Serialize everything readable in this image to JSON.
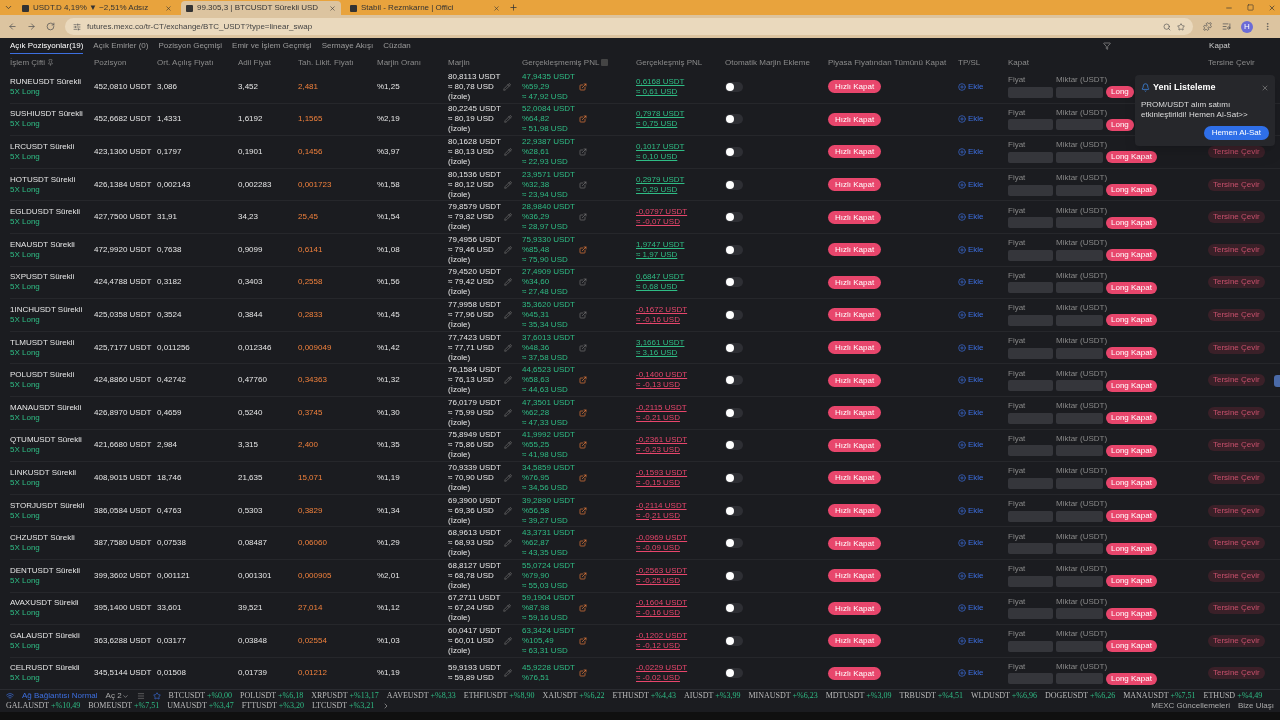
{
  "browser": {
    "tabs": [
      {
        "title": "USDT.D 4,19% ▼ −2,51% Adsız",
        "selected": false
      },
      {
        "title": "99.305,3 | BTCUSDT Sürekli USD",
        "selected": true
      },
      {
        "title": "Stabil - Rezmkarne | Offici",
        "selected": false
      }
    ],
    "url": "futures.mexc.co/tr-CT/exchange/BTC_USDT?type=linear_swap",
    "avatar": "H"
  },
  "tabs": [
    {
      "label": "Açık Pozisyonlar(19)",
      "selected": true
    },
    {
      "label": "Açık Emirler (0)",
      "selected": false
    },
    {
      "label": "Pozisyon Geçmişi",
      "selected": false
    },
    {
      "label": "Emir ve İşlem Geçmişi",
      "selected": false
    },
    {
      "label": "Sermaye Akışı",
      "selected": false
    },
    {
      "label": "Cüzdan",
      "selected": false
    }
  ],
  "tabs_right": "Kapat",
  "columns": [
    "İşlem Çifti",
    "Pozisyon",
    "Ort. Açılış Fiyatı",
    "Adil Fiyat",
    "Tah. Likit. Fiyatı",
    "Marjin Oranı",
    "Marjin",
    "Gerçekleşmemiş PNL",
    "Gerçekleşmiş PNL",
    "Otomatik Marjin Ekleme",
    "Piyasa Fiyatından Tümünü Kapat",
    "TP/SL",
    "Kapat",
    "Tersine Çevir"
  ],
  "rows": [
    {
      "pair": "RUNEUSDT Sürekli",
      "leverage": "5X Long",
      "position": "452,0810 USDT",
      "entry": "3,086",
      "fair": "3,452",
      "liq": "2,481",
      "ratio": "%1,25",
      "margin": [
        "80,8113 USDT",
        "≈ 80,78 USD",
        "(İzole)"
      ],
      "unrealized": [
        "47,9435 USDT",
        "%59,29",
        "≈ 47,92 USD"
      ],
      "share_highlighted": true,
      "realized": [
        "0,6168 USDT",
        "≈ 0,61 USD"
      ],
      "positive": true,
      "auto_margin_on": false,
      "quick_close": "Hızlı Kapat",
      "tpsl": "Ekle",
      "price_label": "Fiyat",
      "qty_label": "Miktar (USDT)",
      "close": "Long"
    },
    {
      "pair": "SUSHIUSDT Sürekli",
      "leverage": "5X Long",
      "position": "452,6682 USDT",
      "entry": "1,4331",
      "fair": "1,6192",
      "liq": "1,1565",
      "ratio": "%2,19",
      "margin": [
        "80,2245 USDT",
        "≈ 80,19 USD",
        "(İzole)"
      ],
      "unrealized": [
        "52,0084 USDT",
        "%64,82",
        "≈ 51,98 USD"
      ],
      "share_highlighted": true,
      "realized": [
        "0,7978 USDT",
        "≈ 0,75 USD"
      ],
      "positive": true,
      "auto_margin_on": false,
      "quick_close": "Hızlı Kapat",
      "tpsl": "Ekle",
      "price_label": "Fiyat",
      "qty_label": "Miktar (USDT)",
      "close": "Long"
    },
    {
      "pair": "LRCUSDT Sürekli",
      "leverage": "5X Long",
      "position": "423,1300 USDT",
      "entry": "0,1797",
      "fair": "0,1901",
      "liq": "0,1456",
      "ratio": "%3,97",
      "margin": [
        "80,1628 USDT",
        "≈ 80,13 USD",
        "(İzole)"
      ],
      "unrealized": [
        "22,9387 USDT",
        "%28,61",
        "≈ 22,93 USD"
      ],
      "share_highlighted": false,
      "realized": [
        "0,1017 USDT",
        "≈ 0,10 USD"
      ],
      "positive": true,
      "auto_margin_on": false,
      "quick_close": "Hızlı Kapat",
      "tpsl": "Ekle",
      "price_label": "Fiyat",
      "qty_label": "Miktar (USDT)",
      "close": "Long Kapat",
      "reverse": "Tersine Çevir"
    },
    {
      "pair": "HOTUSDT Sürekli",
      "leverage": "5X Long",
      "position": "426,1384 USDT",
      "entry": "0,002143",
      "fair": "0,002283",
      "liq": "0,001723",
      "ratio": "%1,58",
      "margin": [
        "80,1536 USDT",
        "≈ 80,12 USD",
        "(İzole)"
      ],
      "unrealized": [
        "23,9571 USDT",
        "%32,38",
        "≈ 23,94 USD"
      ],
      "share_highlighted": false,
      "realized": [
        "0,2979 USDT",
        "≈ 0,29 USD"
      ],
      "positive": true,
      "auto_margin_on": false,
      "quick_close": "Hızlı Kapat",
      "tpsl": "Ekle",
      "price_label": "Fiyat",
      "qty_label": "Miktar (USDT)",
      "close": "Long Kapat",
      "reverse": "Tersine Çevir"
    },
    {
      "pair": "EGLDUSDT Sürekli",
      "leverage": "5X Long",
      "position": "427,7500 USDT",
      "entry": "31,91",
      "fair": "34,23",
      "liq": "25,45",
      "ratio": "%1,54",
      "margin": [
        "79,8579 USDT",
        "≈ 79,82 USD",
        "(İzole)"
      ],
      "unrealized": [
        "28,9840 USDT",
        "%36,29",
        "≈ 28,97 USD"
      ],
      "share_highlighted": false,
      "realized": [
        "-0,0797 USDT",
        "≈ -0,07 USD"
      ],
      "positive": false,
      "auto_margin_on": false,
      "quick_close": "Hızlı Kapat",
      "tpsl": "Ekle",
      "price_label": "Fiyat",
      "qty_label": "Miktar (USDT)",
      "close": "Long Kapat",
      "reverse": "Tersine Çevir"
    },
    {
      "pair": "ENAUSDT Sürekli",
      "leverage": "5X Long",
      "position": "472,9920 USDT",
      "entry": "0,7638",
      "fair": "0,9099",
      "liq": "0,6141",
      "ratio": "%1,08",
      "margin": [
        "79,4956 USDT",
        "≈ 79,46 USD",
        "(İzole)"
      ],
      "unrealized": [
        "75,9330 USDT",
        "%85,48",
        "≈ 75,90 USD"
      ],
      "share_highlighted": true,
      "realized": [
        "1,9747 USDT",
        "≈ 1,97 USD"
      ],
      "positive": true,
      "auto_margin_on": false,
      "quick_close": "Hızlı Kapat",
      "tpsl": "Ekle",
      "price_label": "Fiyat",
      "qty_label": "Miktar (USDT)",
      "close": "Long Kapat",
      "reverse": "Tersine Çevir"
    },
    {
      "pair": "SXPUSDT Sürekli",
      "leverage": "5X Long",
      "position": "424,4788 USDT",
      "entry": "0,3182",
      "fair": "0,3403",
      "liq": "0,2558",
      "ratio": "%1,56",
      "margin": [
        "79,4520 USDT",
        "≈ 79,42 USD",
        "(İzole)"
      ],
      "unrealized": [
        "27,4909 USDT",
        "%34,60",
        "≈ 27,48 USD"
      ],
      "share_highlighted": false,
      "realized": [
        "0,6847 USDT",
        "≈ 0,68 USD"
      ],
      "positive": true,
      "auto_margin_on": false,
      "quick_close": "Hızlı Kapat",
      "tpsl": "Ekle",
      "price_label": "Fiyat",
      "qty_label": "Miktar (USDT)",
      "close": "Long Kapat",
      "reverse": "Tersine Çevir"
    },
    {
      "pair": "1INCHUSDT Sürekli",
      "leverage": "5X Long",
      "position": "425,0358 USDT",
      "entry": "0,3524",
      "fair": "0,3844",
      "liq": "0,2833",
      "ratio": "%1,45",
      "margin": [
        "77,9958 USDT",
        "≈ 77,96 USD",
        "(İzole)"
      ],
      "unrealized": [
        "35,3620 USDT",
        "%45,31",
        "≈ 35,34 USD"
      ],
      "share_highlighted": false,
      "realized": [
        "-0,1672 USDT",
        "≈ -0,16 USD"
      ],
      "positive": false,
      "auto_margin_on": false,
      "quick_close": "Hızlı Kapat",
      "tpsl": "Ekle",
      "price_label": "Fiyat",
      "qty_label": "Miktar (USDT)",
      "close": "Long Kapat",
      "reverse": "Tersine Çevir"
    },
    {
      "pair": "TLMUSDT Sürekli",
      "leverage": "5X Long",
      "position": "425,7177 USDT",
      "entry": "0,011256",
      "fair": "0,012346",
      "liq": "0,009049",
      "ratio": "%1,42",
      "margin": [
        "77,7423 USDT",
        "≈ 77,71 USD",
        "(İzole)"
      ],
      "unrealized": [
        "37,6013 USDT",
        "%48,36",
        "≈ 37,58 USD"
      ],
      "share_highlighted": false,
      "realized": [
        "3,1661 USDT",
        "≈ 3,16 USD"
      ],
      "positive": true,
      "auto_margin_on": false,
      "quick_close": "Hızlı Kapat",
      "tpsl": "Ekle",
      "price_label": "Fiyat",
      "qty_label": "Miktar (USDT)",
      "close": "Long Kapat",
      "reverse": "Tersine Çevir"
    },
    {
      "pair": "POLUSDT Sürekli",
      "leverage": "5X Long",
      "position": "424,8860 USDT",
      "entry": "0,42742",
      "fair": "0,47760",
      "liq": "0,34363",
      "ratio": "%1,32",
      "margin": [
        "76,1584 USDT",
        "≈ 76,13 USD",
        "(İzole)"
      ],
      "unrealized": [
        "44,6523 USDT",
        "%58,63",
        "≈ 44,63 USD"
      ],
      "share_highlighted": true,
      "realized": [
        "-0,1400 USDT",
        "≈ -0,13 USD"
      ],
      "positive": false,
      "auto_margin_on": false,
      "quick_close": "Hızlı Kapat",
      "tpsl": "Ekle",
      "price_label": "Fiyat",
      "qty_label": "Miktar (USDT)",
      "close": "Long Kapat",
      "reverse": "Tersine Çevir"
    },
    {
      "pair": "MANAUSDT Sürekli",
      "leverage": "5X Long",
      "position": "426,8970 USDT",
      "entry": "0,4659",
      "fair": "0,5240",
      "liq": "0,3745",
      "ratio": "%1,30",
      "margin": [
        "76,0179 USDT",
        "≈ 75,99 USD",
        "(İzole)"
      ],
      "unrealized": [
        "47,3501 USDT",
        "%62,28",
        "≈ 47,33 USD"
      ],
      "share_highlighted": true,
      "realized": [
        "-0,2115 USDT",
        "≈ -0,21 USD"
      ],
      "positive": false,
      "auto_margin_on": false,
      "quick_close": "Hızlı Kapat",
      "tpsl": "Ekle",
      "price_label": "Fiyat",
      "qty_label": "Miktar (USDT)",
      "close": "Long Kapat",
      "reverse": "Tersine Çevir"
    },
    {
      "pair": "QTUMUSDT Sürekli",
      "leverage": "5X Long",
      "position": "421,6680 USDT",
      "entry": "2,984",
      "fair": "3,315",
      "liq": "2,400",
      "ratio": "%1,35",
      "margin": [
        "75,8949 USDT",
        "≈ 75,86 USD",
        "(İzole)"
      ],
      "unrealized": [
        "41,9992 USDT",
        "%55,25",
        "≈ 41,98 USD"
      ],
      "share_highlighted": true,
      "realized": [
        "-0,2361 USDT",
        "≈ -0,23 USD"
      ],
      "positive": false,
      "auto_margin_on": false,
      "quick_close": "Hızlı Kapat",
      "tpsl": "Ekle",
      "price_label": "Fiyat",
      "qty_label": "Miktar (USDT)",
      "close": "Long Kapat",
      "reverse": "Tersine Çevir"
    },
    {
      "pair": "LINKUSDT Sürekli",
      "leverage": "5X Long",
      "position": "408,9015 USDT",
      "entry": "18,746",
      "fair": "21,635",
      "liq": "15,071",
      "ratio": "%1,19",
      "margin": [
        "70,9339 USDT",
        "≈ 70,90 USD",
        "(İzole)"
      ],
      "unrealized": [
        "34,5859 USDT",
        "%76,95",
        "≈ 34,56 USD"
      ],
      "share_highlighted": true,
      "realized": [
        "-0,1593 USDT",
        "≈ -0,15 USD"
      ],
      "positive": false,
      "auto_margin_on": false,
      "quick_close": "Hızlı Kapat",
      "tpsl": "Ekle",
      "price_label": "Fiyat",
      "qty_label": "Miktar (USDT)",
      "close": "Long Kapat",
      "reverse": "Tersine Çevir"
    },
    {
      "pair": "STORJUSDT Sürekli",
      "leverage": "5X Long",
      "position": "386,0584 USDT",
      "entry": "0,4763",
      "fair": "0,5303",
      "liq": "0,3829",
      "ratio": "%1,34",
      "margin": [
        "69,3900 USDT",
        "≈ 69,36 USD",
        "(İzole)"
      ],
      "unrealized": [
        "39,2890 USDT",
        "%56,58",
        "≈ 39,27 USD"
      ],
      "share_highlighted": true,
      "realized": [
        "-0,2114 USDT",
        "≈ -0,21 USD"
      ],
      "positive": false,
      "auto_margin_on": false,
      "quick_close": "Hızlı Kapat",
      "tpsl": "Ekle",
      "price_label": "Fiyat",
      "qty_label": "Miktar (USDT)",
      "close": "Long Kapat",
      "reverse": "Tersine Çevir"
    },
    {
      "pair": "CHZUSDT Sürekli",
      "leverage": "5X Long",
      "position": "387,7580 USDT",
      "entry": "0,07538",
      "fair": "0,08487",
      "liq": "0,06060",
      "ratio": "%1,29",
      "margin": [
        "68,9613 USDT",
        "≈ 68,93 USD",
        "(İzole)"
      ],
      "unrealized": [
        "43,3731 USDT",
        "%62,87",
        "≈ 43,35 USD"
      ],
      "share_highlighted": true,
      "realized": [
        "-0,0969 USDT",
        "≈ -0,09 USD"
      ],
      "positive": false,
      "auto_margin_on": false,
      "quick_close": "Hızlı Kapat",
      "tpsl": "Ekle",
      "price_label": "Fiyat",
      "qty_label": "Miktar (USDT)",
      "close": "Long Kapat",
      "reverse": "Tersine Çevir"
    },
    {
      "pair": "DENTUSDT Sürekli",
      "leverage": "5X Long",
      "position": "399,3602 USDT",
      "entry": "0,001121",
      "fair": "0,001301",
      "liq": "0,000905",
      "ratio": "%2,01",
      "margin": [
        "68,8127 USDT",
        "≈ 68,78 USD",
        "(İzole)"
      ],
      "unrealized": [
        "55,0724 USDT",
        "%79,90",
        "≈ 55,03 USD"
      ],
      "share_highlighted": true,
      "realized": [
        "-0,2563 USDT",
        "≈ -0,25 USD"
      ],
      "positive": false,
      "auto_margin_on": false,
      "quick_close": "Hızlı Kapat",
      "tpsl": "Ekle",
      "price_label": "Fiyat",
      "qty_label": "Miktar (USDT)",
      "close": "Long Kapat",
      "reverse": "Tersine Çevir"
    },
    {
      "pair": "AVAXUSDT Sürekli",
      "leverage": "5X Long",
      "position": "395,1400 USDT",
      "entry": "33,601",
      "fair": "39,521",
      "liq": "27,014",
      "ratio": "%1,12",
      "margin": [
        "67,2711 USDT",
        "≈ 67,24 USD",
        "(İzole)"
      ],
      "unrealized": [
        "59,1904 USDT",
        "%87,98",
        "≈ 59,16 USD"
      ],
      "share_highlighted": true,
      "realized": [
        "-0,1604 USDT",
        "≈ -0,16 USD"
      ],
      "positive": false,
      "auto_margin_on": false,
      "quick_close": "Hızlı Kapat",
      "tpsl": "Ekle",
      "price_label": "Fiyat",
      "qty_label": "Miktar (USDT)",
      "close": "Long Kapat",
      "reverse": "Tersine Çevir"
    },
    {
      "pair": "GALAUSDT Sürekli",
      "leverage": "5X Long",
      "position": "363,6288 USDT",
      "entry": "0,03177",
      "fair": "0,03848",
      "liq": "0,02554",
      "ratio": "%1,03",
      "margin": [
        "60,0417 USDT",
        "≈ 60,01 USD",
        "(İzole)"
      ],
      "unrealized": [
        "63,3424 USDT",
        "%105,49",
        "≈ 63,31 USD"
      ],
      "share_highlighted": true,
      "realized": [
        "-0,1202 USDT",
        "≈ -0,12 USD"
      ],
      "positive": false,
      "auto_margin_on": false,
      "quick_close": "Hızlı Kapat",
      "tpsl": "Ekle",
      "price_label": "Fiyat",
      "qty_label": "Miktar (USDT)",
      "close": "Long Kapat",
      "reverse": "Tersine Çevir"
    },
    {
      "pair": "CELRUSDT Sürekli",
      "leverage": "5X Long",
      "position": "345,5144 USDT",
      "entry": "0,01508",
      "fair": "0,01739",
      "liq": "0,01212",
      "ratio": "%1,19",
      "margin": [
        "59,9193 USDT",
        "≈ 59,89 USD"
      ],
      "unrealized": [
        "45,9228 USDT",
        "%76,51"
      ],
      "share_highlighted": true,
      "realized": [
        "-0,0229 USDT",
        "≈ -0,02 USD"
      ],
      "positive": false,
      "auto_margin_on": false,
      "quick_close": "Hızlı Kapat",
      "tpsl": "Ekle",
      "price_label": "Fiyat",
      "qty_label": "Miktar (USDT)",
      "close": "Long Kapat",
      "reverse": "Tersine Çevir"
    }
  ],
  "notification": {
    "title": "Yeni Listeleme",
    "message": "PROM/USDT alım satımı etkinleştirildi! Hemen Al-Sat>>",
    "button": "Hemen Al-Sat"
  },
  "status_bar": {
    "network": "Ağ Bağlantısı Normal",
    "menu": "Aç 2",
    "ticker": [
      {
        "symbol": "BTCUSDT",
        "change": "+%0,00"
      },
      {
        "symbol": "POLUSDT",
        "change": "+%6,18"
      },
      {
        "symbol": "XRPUSDT",
        "change": "+%13,17"
      },
      {
        "symbol": "AAVEUSDT",
        "change": "+%8,33"
      },
      {
        "symbol": "ETHFIUSDT",
        "change": "+%8,90"
      },
      {
        "symbol": "XAIUSDT",
        "change": "+%6,22"
      },
      {
        "symbol": "ETHUSDT",
        "change": "+%4,43"
      },
      {
        "symbol": "AIUSDT",
        "change": "+%3,99"
      },
      {
        "symbol": "MINAUSDT",
        "change": "+%6,23"
      },
      {
        "symbol": "MDTUSDT",
        "change": "+%3,09"
      },
      {
        "symbol": "TRBUSDT",
        "change": "+%4,51"
      },
      {
        "symbol": "WLDUSDT",
        "change": "+%6,96"
      },
      {
        "symbol": "DOGEUSDT",
        "change": "+%6,26"
      },
      {
        "symbol": "MANAUSDT",
        "change": "+%7,51"
      },
      {
        "symbol": "ETHUSD",
        "change": "+%4,49"
      },
      {
        "symbol": "GALAUSDT",
        "change": "+%10,49"
      },
      {
        "symbol": "BOMEUSDT",
        "change": "+%7,51"
      },
      {
        "symbol": "UMAUSDT",
        "change": "+%3,47"
      },
      {
        "symbol": "FTTUSDT",
        "change": "+%3,20"
      },
      {
        "symbol": "LTCUSDT",
        "change": "+%3,21"
      }
    ],
    "updates": "MEXC Güncellemeleri",
    "contact": "Bize Ulaşı"
  }
}
